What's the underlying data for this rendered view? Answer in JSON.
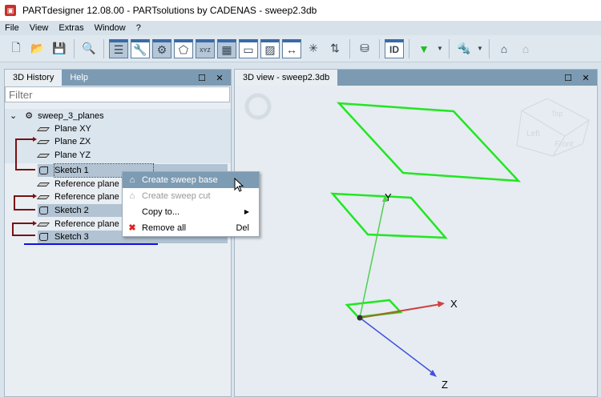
{
  "window": {
    "title": "PARTdesigner 12.08.00 - PARTsolutions by CADENAS - sweep2.3db"
  },
  "menu": [
    "File",
    "View",
    "Extras",
    "Window",
    "?"
  ],
  "left_panel": {
    "tabs": [
      "3D History",
      "Help"
    ],
    "filter_placeholder": "Filter",
    "tree": [
      {
        "label": "sweep_3_planes",
        "type": "part"
      },
      {
        "label": "Plane XY",
        "type": "plane"
      },
      {
        "label": "Plane ZX",
        "type": "plane"
      },
      {
        "label": "Plane YZ",
        "type": "plane"
      },
      {
        "label": "Sketch 1",
        "type": "sketch",
        "selected": true
      },
      {
        "label": "Reference plane 1",
        "type": "plane"
      },
      {
        "label": "Reference plane 2",
        "type": "plane"
      },
      {
        "label": "Sketch 2",
        "type": "sketch",
        "selected": true
      },
      {
        "label": "Reference plane 3",
        "type": "plane"
      },
      {
        "label": "Sketch 3",
        "type": "sketch",
        "selected": true
      }
    ]
  },
  "context_menu": [
    {
      "label": "Create sweep base",
      "icon": "sweep-base-icon",
      "highlighted": true
    },
    {
      "label": "Create sweep cut",
      "icon": "sweep-cut-icon",
      "disabled": true
    },
    {
      "label": "Copy to...",
      "submenu": true
    },
    {
      "label": "Remove all",
      "icon": "remove-icon",
      "shortcut": "Del"
    }
  ],
  "view_panel": {
    "tab": "3D view - sweep2.3db",
    "cube": {
      "top": "Top",
      "left": "Left",
      "front": "Front"
    },
    "axes": {
      "x": "X",
      "y": "Y",
      "z": "Z"
    }
  },
  "colors": {
    "sketch": "#22e622",
    "axis_x": "#e04040",
    "axis_y": "#40d040",
    "axis_z": "#4050e0"
  }
}
